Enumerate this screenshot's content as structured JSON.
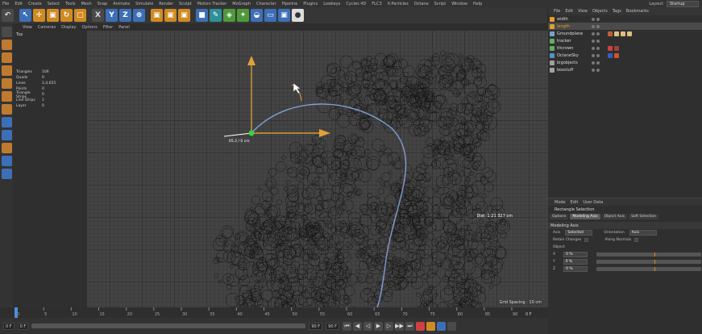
{
  "menubar": {
    "items": [
      "File",
      "Edit",
      "Create",
      "Select",
      "Tools",
      "Mesh",
      "Snap",
      "Animate",
      "Simulate",
      "Render",
      "Sculpt",
      "Motion Tracker",
      "MoGraph",
      "Character",
      "Pipeline",
      "Plugins",
      "Lowkeys",
      "Cycles 4D",
      "FLC3",
      "X-Particles",
      "Octane",
      "Script",
      "Window",
      "Help"
    ],
    "layout_label": "Layout:",
    "layout_value": "Startup"
  },
  "toolbar": {
    "buttons": [
      {
        "icon": "undo-icon",
        "label": "↶",
        "style": "gray"
      },
      {
        "icon": "select-arrow-icon",
        "label": "↖",
        "style": "blue"
      },
      {
        "icon": "move-icon",
        "label": "✛",
        "style": "orange"
      },
      {
        "icon": "scale-icon",
        "label": "▣",
        "style": "orange"
      },
      {
        "icon": "rotate-icon",
        "label": "↻",
        "style": "orange"
      },
      {
        "icon": "recent-tools-icon",
        "label": "▢",
        "style": "orange"
      },
      {
        "icon": "axis-x-icon",
        "label": "X",
        "style": "gray"
      },
      {
        "icon": "axis-y-icon",
        "label": "Y",
        "style": "blue"
      },
      {
        "icon": "axis-z-icon",
        "label": "Z",
        "style": "blue"
      },
      {
        "icon": "coordinate-system-icon",
        "label": "⊕",
        "style": "blue"
      },
      {
        "icon": "record-icon",
        "label": "▣",
        "style": "orange"
      },
      {
        "icon": "autokey-icon",
        "label": "▣",
        "style": "orange"
      },
      {
        "icon": "render-icon",
        "label": "▣",
        "style": "orange"
      },
      {
        "icon": "cube-icon",
        "label": "■",
        "style": "blue"
      },
      {
        "icon": "pen-icon",
        "label": "✎",
        "style": "teal"
      },
      {
        "icon": "subdivision-icon",
        "label": "◈",
        "style": "green"
      },
      {
        "icon": "array-icon",
        "label": "✦",
        "style": "green"
      },
      {
        "icon": "deformer-icon",
        "label": "◒",
        "style": "blue"
      },
      {
        "icon": "floor-icon",
        "label": "▭",
        "style": "blue"
      },
      {
        "icon": "camera-icon",
        "label": "▣",
        "style": "blue"
      },
      {
        "icon": "light-icon",
        "label": "●",
        "style": "white"
      }
    ]
  },
  "viewport": {
    "menu": [
      "View",
      "Cameras",
      "Display",
      "Options",
      "Filter",
      "Panel"
    ],
    "label": "Top",
    "stats": [
      {
        "k": "Triangles",
        "v": "106"
      },
      {
        "k": "Quads",
        "v": "0"
      },
      {
        "k": "Lines",
        "v": "2,4,655"
      },
      {
        "k": "Points",
        "v": "0"
      },
      {
        "k": "Triangle Strips",
        "v": "0"
      },
      {
        "k": "Line Strips",
        "v": "1"
      },
      {
        "k": "Layer",
        "v": "0"
      }
    ],
    "coord_label": "65.2 / 0 cm",
    "dist_label": "Dist: 1 21 327 cm",
    "grid_spacing": "Grid Spacing : 10 cm"
  },
  "timeline": {
    "ticks": [
      "0",
      "5",
      "10",
      "15",
      "20",
      "25",
      "30",
      "35",
      "40",
      "45",
      "50",
      "55",
      "60",
      "65",
      "70",
      "75",
      "80",
      "85",
      "90"
    ],
    "end_label": "0 F"
  },
  "transport": {
    "start": "0 F",
    "current": "0 F",
    "end": "90 F",
    "end2": "90 F",
    "buttons": [
      "⏮",
      "◀",
      "◁",
      "▶",
      "▷",
      "▶▶",
      "⏭"
    ]
  },
  "objects": {
    "menu": [
      "File",
      "Edit",
      "View",
      "Objects",
      "Tags",
      "Bookmarks"
    ],
    "rows": [
      {
        "name": "width",
        "color": "#e0a030",
        "sel": false,
        "tags": []
      },
      {
        "name": "length",
        "color": "#e0a030",
        "sel": true,
        "tags": []
      },
      {
        "name": "Groundplane",
        "color": "#7aa0d0",
        "sel": false,
        "tags": [
          "#c06030",
          "#e0c080",
          "#e0c080",
          "#e0c080"
        ]
      },
      {
        "name": "tracker",
        "color": "#60b060",
        "sel": false,
        "tags": []
      },
      {
        "name": "titcrown",
        "color": "#60b060",
        "sel": false,
        "tags": [
          "#d04040",
          "#a04040"
        ]
      },
      {
        "name": "OctaneSky",
        "color": "#5090d0",
        "sel": false,
        "tags": [
          "#3060c0",
          "#d05030"
        ]
      },
      {
        "name": "bigobjects",
        "color": "#a0a0a0",
        "sel": false,
        "tags": []
      },
      {
        "name": "boxstuff",
        "color": "#a0a0a0",
        "sel": false,
        "tags": []
      }
    ]
  },
  "attributes": {
    "menu": [
      "Mode",
      "Edit",
      "User Data"
    ],
    "title": "Rectangle Selection",
    "tabs": [
      "Options",
      "Modeling Axis",
      "Object Axis",
      "Soft Selection"
    ],
    "active_tab": 1,
    "section": "Modeling Axis",
    "axis_label": "Axis",
    "axis_value": "Selected",
    "orientation_label": "Orientation",
    "orientation_value": "Axis",
    "retain_label": "Retain Changes",
    "along_normals_label": "Along Normals",
    "object_label": "Object",
    "xyz": [
      {
        "k": "X",
        "v": "0 %"
      },
      {
        "k": "Y",
        "v": "0 %"
      },
      {
        "k": "Z",
        "v": "0 %"
      }
    ]
  }
}
